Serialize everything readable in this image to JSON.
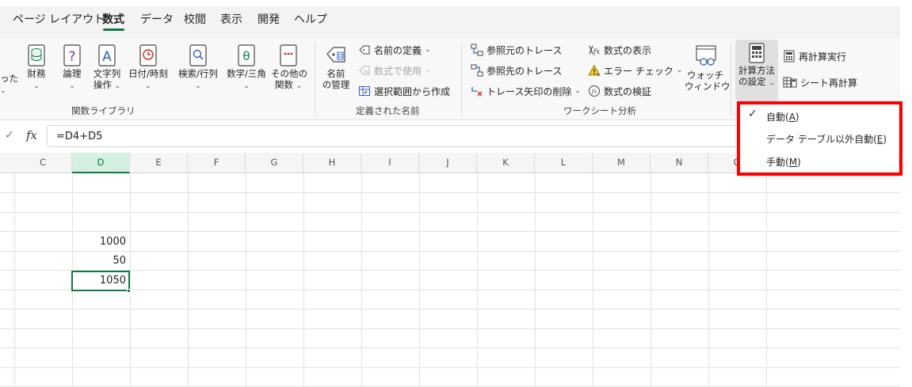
{
  "tabs": [
    {
      "label": "ページ レイアウト",
      "active": false
    },
    {
      "label": "数式",
      "active": true
    },
    {
      "label": "データ",
      "active": false
    },
    {
      "label": "校閲",
      "active": false
    },
    {
      "label": "表示",
      "active": false
    },
    {
      "label": "開発",
      "active": false
    },
    {
      "label": "ヘルプ",
      "active": false
    }
  ],
  "ribbon": {
    "function_library": {
      "partial_label": "った",
      "buttons": [
        {
          "label1": "財務",
          "label2": ""
        },
        {
          "label1": "論理",
          "label2": ""
        },
        {
          "label1": "文字列",
          "label2": "操作"
        },
        {
          "label1": "日付/時刻",
          "label2": ""
        },
        {
          "label1": "検索/行列",
          "label2": ""
        },
        {
          "label1": "数学/三角",
          "label2": ""
        },
        {
          "label1": "その他の",
          "label2": "関数"
        }
      ],
      "group_label": "関数ライブラリ"
    },
    "defined_names": {
      "name_manager_l1": "名前",
      "name_manager_l2": "の管理",
      "define_name": "名前の定義",
      "use_in_formula": "数式で使用",
      "create_from_selection": "選択範囲から作成",
      "group_label": "定義された名前"
    },
    "formula_auditing": {
      "trace_precedents": "参照元のトレース",
      "trace_dependents": "参照先のトレース",
      "remove_arrows": "トレース矢印の削除",
      "show_formulas": "数式の表示",
      "error_checking": "エラー チェック",
      "evaluate_formula": "数式の検証",
      "watch_l1": "ウォッチ",
      "watch_l2": "ウィンドウ",
      "group_label": "ワークシート分析"
    },
    "calculation": {
      "options_l1": "計算方法",
      "options_l2": "の設定",
      "calc_now": "再計算実行",
      "calc_sheet": "シート再計算"
    }
  },
  "formula_bar": {
    "fx": "fx",
    "formula": "=D4+D5"
  },
  "columns": [
    "C",
    "D",
    "E",
    "F",
    "G",
    "H",
    "I",
    "J",
    "K",
    "L",
    "M",
    "N",
    "O"
  ],
  "selected_column": "D",
  "cells": {
    "d4": "1000",
    "d5": "50",
    "d6": "1050"
  },
  "calc_menu": {
    "items": [
      {
        "label": "自動(",
        "key": "A",
        "suffix": ")",
        "checked": true
      },
      {
        "label": "データ テーブル以外自動(",
        "key": "E",
        "suffix": ")",
        "checked": false
      },
      {
        "label": "手動(",
        "key": "M",
        "suffix": ")",
        "checked": false
      }
    ],
    "checkmark": "✓"
  },
  "colors": {
    "accent": "#107c41",
    "highlight_box": "#ff0000"
  }
}
